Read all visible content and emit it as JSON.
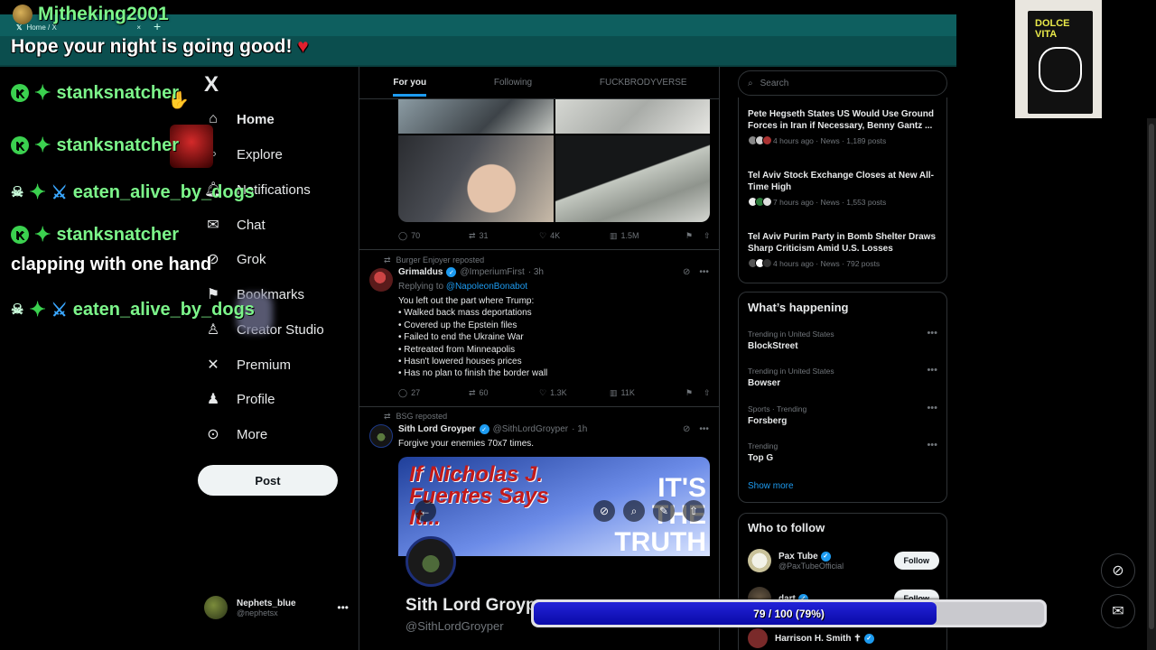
{
  "browser": {
    "tab_title": "Home / X",
    "tab_close": "×",
    "new_tab": "+"
  },
  "overlay": {
    "streamer": "Mjtheking2001",
    "message": "Hope your night is going good!",
    "heart": "♥",
    "chat": [
      {
        "user": "stanksnatcher",
        "style": "k"
      },
      {
        "user": "stanksnatcher",
        "style": "k"
      },
      {
        "user": "eaten_alive_by_dogs",
        "style": "skull"
      },
      {
        "user": "stanksnatcher",
        "style": "k"
      },
      {
        "text": "clapping with one hand"
      },
      {
        "user": "eaten_alive_by_dogs",
        "style": "skull"
      }
    ],
    "goal": {
      "label": "79 / 100 (79%)",
      "current": 79,
      "target": 100
    }
  },
  "nav": {
    "logo": "X",
    "items": [
      {
        "label": "Home",
        "icon": "home-icon"
      },
      {
        "label": "Explore",
        "icon": "search-icon"
      },
      {
        "label": "Notifications",
        "icon": "bell-icon"
      },
      {
        "label": "Chat",
        "icon": "mail-icon"
      },
      {
        "label": "Grok",
        "icon": "grok-icon"
      },
      {
        "label": "Bookmarks",
        "icon": "bookmark-icon"
      },
      {
        "label": "Creator Studio",
        "icon": "creator-icon"
      },
      {
        "label": "Premium",
        "icon": "x-icon"
      },
      {
        "label": "Profile",
        "icon": "person-icon"
      },
      {
        "label": "More",
        "icon": "more-icon"
      }
    ],
    "post_label": "Post",
    "account": {
      "name": "Nephets_blue",
      "handle": "@nephetsx"
    }
  },
  "feed": {
    "tabs": [
      "For you",
      "Following",
      "FUCKBRODYVERSE"
    ],
    "tweet0_actions": {
      "replies": "70",
      "reposts": "31",
      "likes": "4K",
      "views": "1.5M"
    },
    "tweet1": {
      "repost_by": "Burger Enjoyer reposted",
      "name": "Grimaldus",
      "handle": "@ImperiumFirst",
      "time": "· 3h",
      "replying_prefix": "Replying to",
      "replying_to": "@NapoleonBonabot",
      "lines": [
        "You left out the part where Trump:",
        "• Walked back mass deportations",
        "• Covered up the Epstein files",
        "• Failed to end the Ukraine War",
        "• Retreated from Minneapolis",
        "• Hasn't lowered houses prices",
        "• Has no plan to finish the border wall"
      ],
      "actions": {
        "replies": "27",
        "reposts": "60",
        "likes": "1.3K",
        "views": "11K"
      }
    },
    "tweet2": {
      "repost_by": "BSG reposted",
      "name": "Sith Lord Groyper",
      "handle": "@SithLordGroyper",
      "time": "· 1h",
      "text": "Forgive your enemies 70x7 times.",
      "media_banner_left": "If Nicholas J. Fuentes Says It...",
      "media_banner_right": "IT'S THE TRUTH",
      "media_name": "Sith Lord Groyp",
      "media_handle": "@SithLordGroyper"
    }
  },
  "right": {
    "search_placeholder": "Search",
    "news": [
      {
        "title": "Pete Hegseth States US Would Use Ground Forces in Iran if Necessary, Benny Gantz ...",
        "meta": "4 hours ago · News · 1,189 posts"
      },
      {
        "title": "Tel Aviv Stock Exchange Closes at New All-Time High",
        "meta": "7 hours ago · News · 1,553 posts"
      },
      {
        "title": "Tel Aviv Purim Party in Bomb Shelter Draws Sharp Criticism Amid U.S. Losses",
        "meta": "4 hours ago · News · 792 posts"
      }
    ],
    "happening_title": "What’s happening",
    "trends": [
      {
        "context": "Trending in United States",
        "name": "BlockStreet"
      },
      {
        "context": "Trending in United States",
        "name": "Bowser"
      },
      {
        "context": "Sports · Trending",
        "name": "Forsberg"
      },
      {
        "context": "Trending",
        "name": "Top G"
      }
    ],
    "show_more": "Show more",
    "wtf_title": "Who to follow",
    "follow": [
      {
        "name": "Pax Tube",
        "handle": "@PaxTubeOfficial",
        "button": "Follow"
      },
      {
        "name": "dart",
        "handle": "",
        "button": "Follow"
      },
      {
        "name": "Harrison H. Smith ✝",
        "handle": "",
        "button": ""
      }
    ]
  },
  "cam": {
    "product_text": "DOLCE VITA"
  },
  "colors": {
    "accent": "#1d9bf0",
    "chat_green": "#7cf58a",
    "goal_fill": "#1414c0",
    "teal_bar": "#0e5f5f"
  }
}
